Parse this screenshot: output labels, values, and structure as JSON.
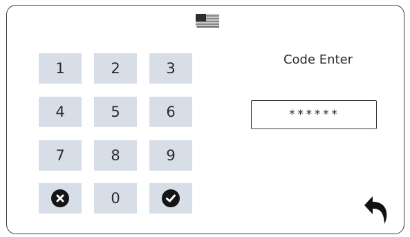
{
  "header": {
    "flag_icon": "us-flag-icon"
  },
  "keypad": {
    "keys": [
      {
        "label": "1"
      },
      {
        "label": "2"
      },
      {
        "label": "3"
      },
      {
        "label": "4"
      },
      {
        "label": "5"
      },
      {
        "label": "6"
      },
      {
        "label": "7"
      },
      {
        "label": "8"
      },
      {
        "label": "9"
      },
      {
        "icon": "clear-icon"
      },
      {
        "label": "0"
      },
      {
        "icon": "confirm-icon"
      }
    ],
    "key_color": "#d8dee7"
  },
  "code": {
    "title": "Code Enter",
    "value": "******"
  },
  "footer": {
    "back_icon": "back-arrow-icon"
  }
}
